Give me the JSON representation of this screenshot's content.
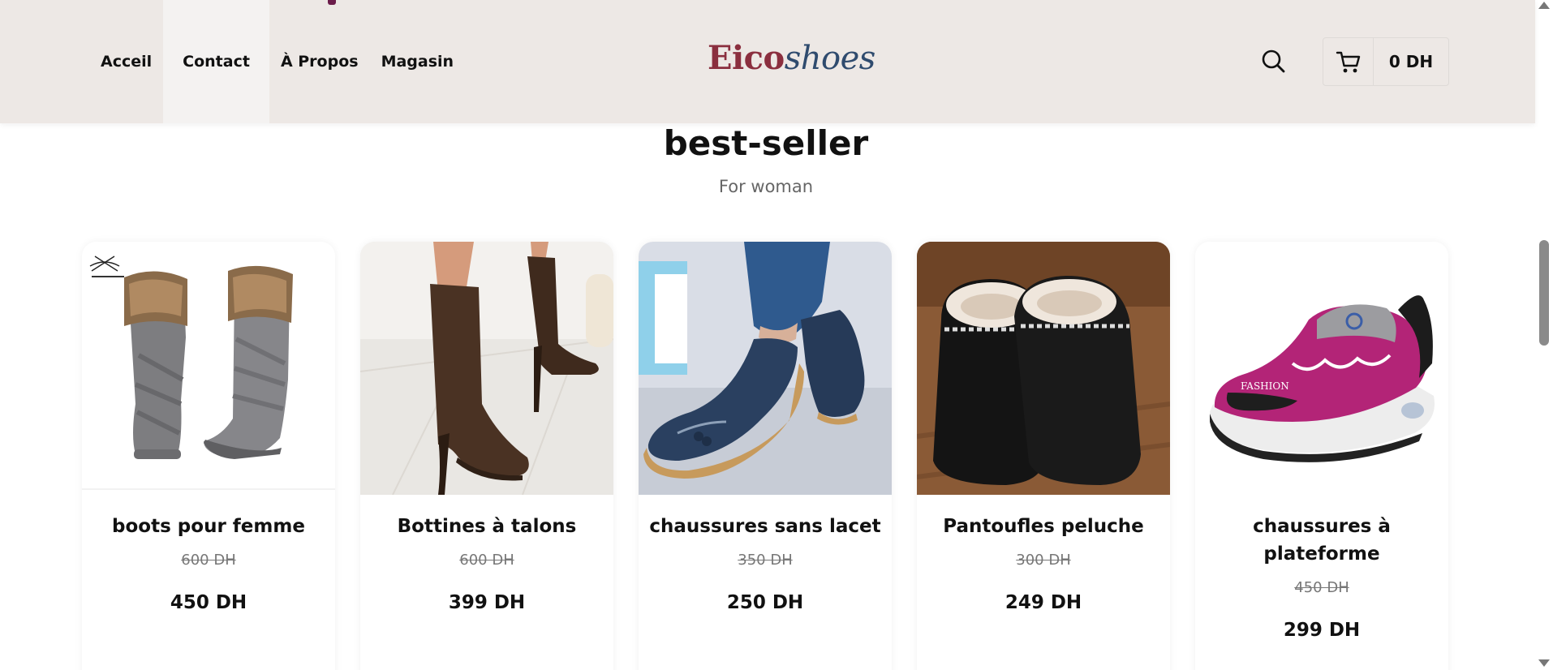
{
  "header": {
    "nav": [
      "Acceil",
      "Contact",
      "À Propos",
      "Magasin"
    ],
    "active_nav": "Contact",
    "logo_part1": "Eico",
    "logo_part2": "shoes",
    "cart_total": "0 DH",
    "icons": [
      "search-icon",
      "cart-icon"
    ]
  },
  "section": {
    "title": "best-seller",
    "subtitle": "For woman"
  },
  "products": [
    {
      "name": "boots pour femme",
      "old_price": "600 DH",
      "price": "450 DH",
      "image": "grey fur-trimmed knee boots"
    },
    {
      "name": "Bottines à talons",
      "old_price": "600 DH",
      "price": "399 DH",
      "image": "brown suede heeled ankle boots"
    },
    {
      "name": "chaussures sans lacet",
      "old_price": "350 DH",
      "price": "250 DH",
      "image": "navy leather slip-on loafers"
    },
    {
      "name": "Pantoufles peluche",
      "old_price": "300 DH",
      "price": "249 DH",
      "image": "black plush-lined slippers"
    },
    {
      "name": "chaussures à plateforme",
      "old_price": "450 DH",
      "price": "299 DH",
      "image": "pink platform sneakers"
    }
  ],
  "product_image_text": [
    "FASHION"
  ],
  "colors": {
    "header_bg": "#ede8e5",
    "logo_primary": "#8b2f3f",
    "logo_secondary": "#2f4b6e"
  }
}
